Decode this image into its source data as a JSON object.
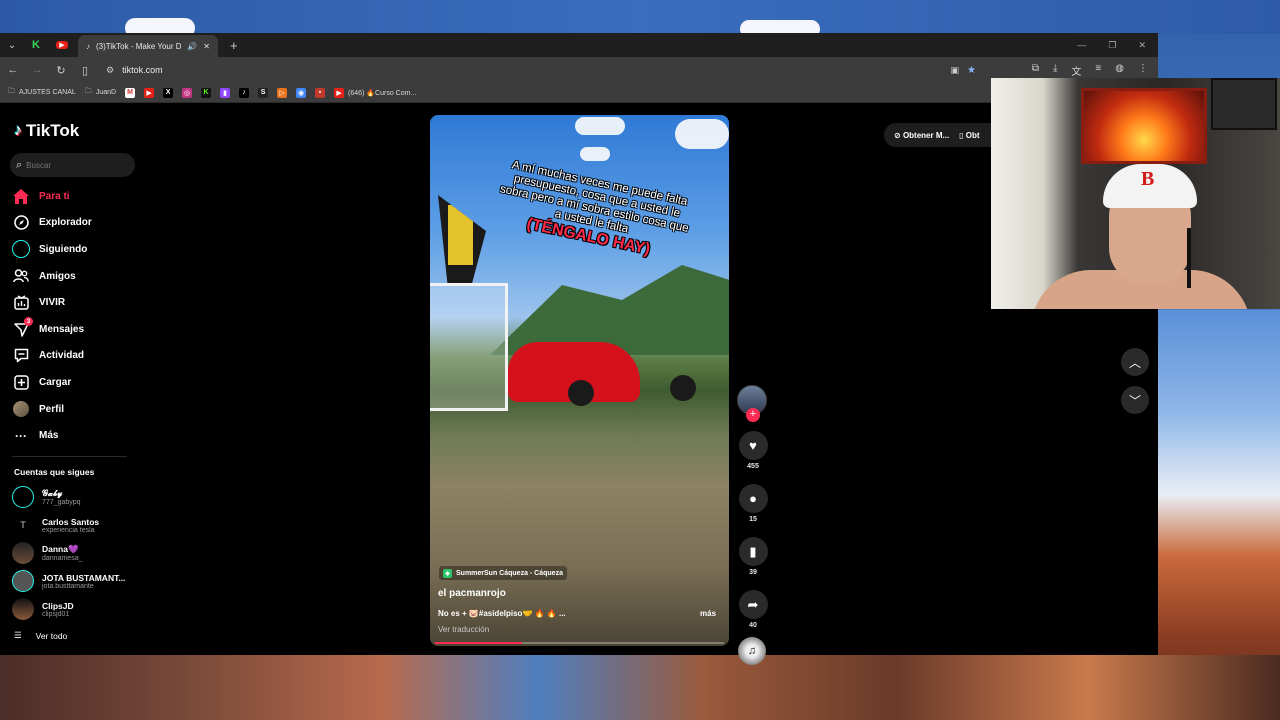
{
  "browser": {
    "tab_title": "(3)TikTok - Make Your Day",
    "url": "tiktok.com",
    "bookmarks": [
      {
        "label": "AJUSTES CANAL",
        "icon": "folder-icon"
      },
      {
        "label": "JuanD",
        "icon": "folder-icon"
      },
      {
        "label": "(646) 🔥Curso Com...",
        "icon": "youtube-icon"
      }
    ]
  },
  "tiktok": {
    "logo": "TikTok",
    "search_placeholder": "Buscar",
    "nav": [
      {
        "label": "Para ti",
        "icon": "home-icon"
      },
      {
        "label": "Explorador",
        "icon": "compass-icon"
      },
      {
        "label": "Siguiendo",
        "icon": "following-ring-icon"
      },
      {
        "label": "Amigos",
        "icon": "friends-icon"
      },
      {
        "label": "VIVIR",
        "icon": "live-icon"
      },
      {
        "label": "Mensajes",
        "icon": "messages-icon",
        "badge": "3"
      },
      {
        "label": "Actividad",
        "icon": "activity-icon"
      },
      {
        "label": "Cargar",
        "icon": "upload-icon"
      },
      {
        "label": "Perfil",
        "icon": "avatar"
      },
      {
        "label": "Más",
        "icon": "more-dots-icon"
      }
    ],
    "following_title": "Cuentas que sigues",
    "following": [
      {
        "name": "𝓖𝓪𝓫𝔂",
        "user": "777_gabypq"
      },
      {
        "name": "Carlos Santos",
        "user": "experiencia tesla"
      },
      {
        "name": "Danna💜",
        "user": "dannamesa_"
      },
      {
        "name": "JOTA BUSTAMANT...",
        "user": "jota.busttamante"
      },
      {
        "name": "ClipsJD",
        "user": "clipsjd01"
      }
    ],
    "see_all": "Ver todo",
    "top_right": {
      "get_app": "Obtener M...",
      "get_app2": "Obt"
    }
  },
  "video": {
    "overlay_text": "A mí muchas veces me puede falta presupuesto, cosa que a usted le sobra pero a mí sobra estilo cosa que a usted le falta",
    "overlay_highlight": "(TÉNGALO HAY)",
    "location": "SummerSun Cáqueza - Cáqueza",
    "author": "el pacmanrojo",
    "caption": "No es + 🐷#asidelpiso🤝 🔥 🔥 ...",
    "more": "más",
    "translate": "Ver traducción",
    "progress_pct": 30,
    "likes": "455",
    "comments": "15",
    "saves": "39",
    "shares": "40"
  }
}
